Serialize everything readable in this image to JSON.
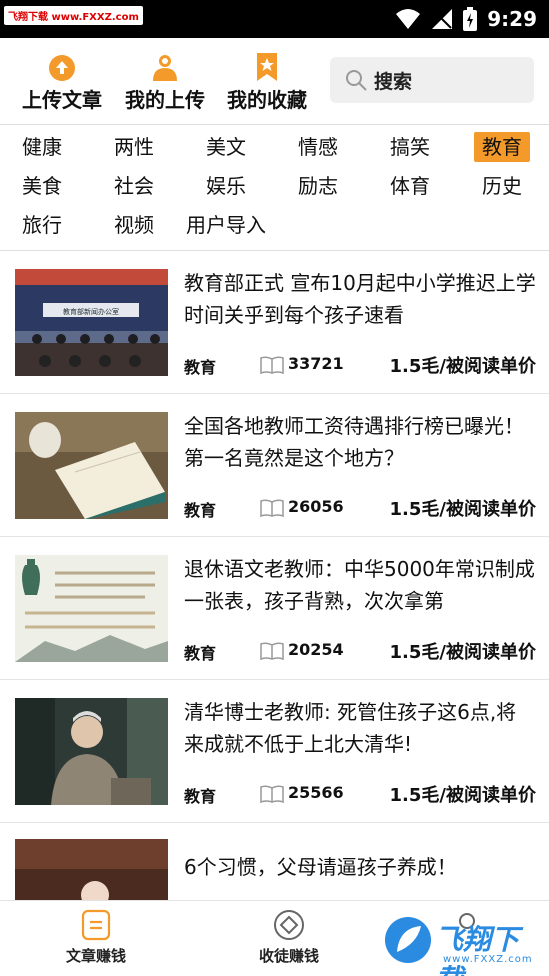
{
  "status_bar": {
    "watermark": "飞翔下载 www.FXXZ.com",
    "time": "9:29"
  },
  "top_actions": {
    "upload_label": "上传文章",
    "my_uploads_label": "我的上传",
    "my_favorites_label": "我的收藏",
    "search_label": "搜索"
  },
  "categories": [
    "健康",
    "两性",
    "美文",
    "情感",
    "搞笑",
    "教育",
    "美食",
    "社会",
    "娱乐",
    "励志",
    "体育",
    "历史",
    "旅行",
    "视频",
    "用户导入"
  ],
  "active_category": "教育",
  "articles": [
    {
      "title": "教育部正式 宣布10月起中小学推迟上学时间关乎到每个孩子速看",
      "category": "教育",
      "reads": "33721",
      "price": "1.5毛/被阅读单价",
      "thumb_text": "教育部新闻办公室"
    },
    {
      "title": "全国各地教师工资待遇排行榜已曝光！第一名竟然是这个地方？",
      "category": "教育",
      "reads": "26056",
      "price": "1.5毛/被阅读单价"
    },
    {
      "title": "退休语文老教师：中华5000年常识制成一张表，孩子背熟，次次拿第",
      "category": "教育",
      "reads": "20254",
      "price": "1.5毛/被阅读单价"
    },
    {
      "title": "清华博士老教师: 死管住孩子这6点,将来成就不低于上北大清华!",
      "category": "教育",
      "reads": "25566",
      "price": "1.5毛/被阅读单价"
    },
    {
      "title": "6个习惯，父母请逼孩子养成！"
    }
  ],
  "bottom_nav": {
    "tab1": "文章赚钱",
    "tab2": "收徒赚钱"
  },
  "logo_watermark": {
    "text": "飞翔下载",
    "sub": "www.FXXZ.com"
  },
  "colors": {
    "accent": "#f39a2a",
    "status_bar": "#000000"
  }
}
